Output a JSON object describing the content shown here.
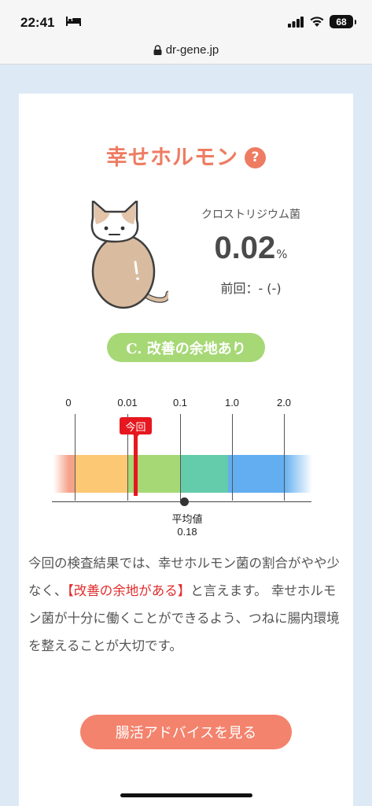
{
  "status_bar": {
    "time": "22:41",
    "battery": "68",
    "icons": [
      "bed-icon",
      "signal-icon",
      "wifi-icon",
      "battery-icon"
    ]
  },
  "browser": {
    "url": "dr-gene.jp"
  },
  "result": {
    "title": "幸せホルモン",
    "help_symbol": "?",
    "bacteria_name": "クロストリジウム菌",
    "value": "0.02",
    "unit": "%",
    "previous": "前回：- (-)",
    "rating": "C. 改善の余地あり"
  },
  "scale": {
    "ticks": [
      "0",
      "0.01",
      "0.1",
      "1.0",
      "2.0"
    ],
    "current_label": "今回",
    "current_value": 0.02,
    "average_label": "平均値",
    "average_value": "0.18",
    "band_colors": [
      "#f6a28b",
      "#fcc874",
      "#a6d876",
      "#64ccaa",
      "#62aef0",
      "#9ccbf6"
    ]
  },
  "description": {
    "part1": "今回の検査結果では、幸せホルモン菌の割合がやや少なく、",
    "highlight": "【改善の余地がある】",
    "part2": "と言えます。 幸せホルモン菌が十分に働くことができるよう、つねに腸内環境を整えることが大切です。"
  },
  "advice_button": "腸活アドバイスを見る"
}
